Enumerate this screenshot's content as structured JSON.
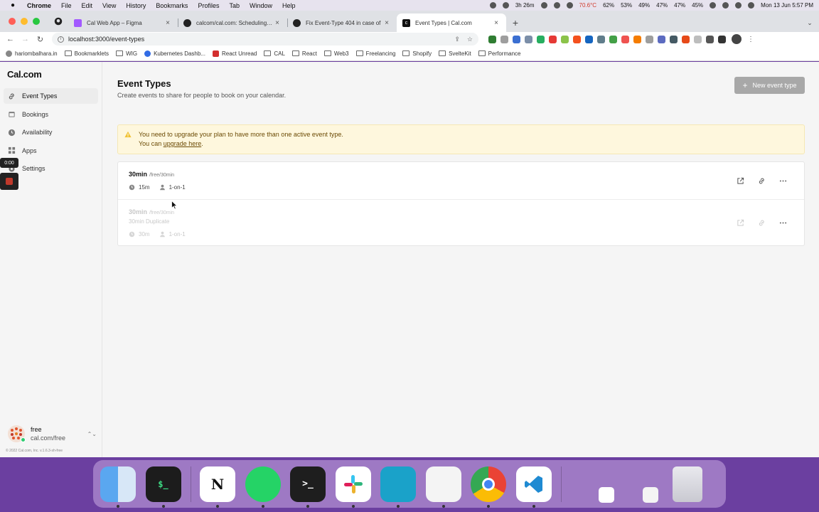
{
  "menubar": {
    "app_name": "Chrome",
    "items": [
      "File",
      "Edit",
      "View",
      "History",
      "Bookmarks",
      "Profiles",
      "Tab",
      "Window",
      "Help"
    ],
    "status": {
      "timer": "3h 26m",
      "temp": "70.6°C",
      "stats": [
        "62%",
        "53%",
        "49%",
        "47%",
        "47%",
        "45%"
      ],
      "datetime": "Mon 13 Jun  5:57 PM"
    }
  },
  "tabs": [
    {
      "title": "Cal Web App – Figma",
      "active": false
    },
    {
      "title": "calcom/cal.com: Scheduling infrastructure",
      "active": false
    },
    {
      "title": "Fix Event-Type 404 in case of",
      "active": false
    },
    {
      "title": "Event Types | Cal.com",
      "active": true
    }
  ],
  "address_bar": {
    "url": "localhost:3000/event-types"
  },
  "bookmarks": [
    "hariombalhara.in",
    "Bookmarklets",
    "WIG",
    "Kubernetes Dashb...",
    "React Unread",
    "CAL",
    "React",
    "Web3",
    "Freelancing",
    "Shopify",
    "SvelteKit",
    "Performance"
  ],
  "sidebar": {
    "brand": "Cal.com",
    "items": [
      {
        "label": "Event Types",
        "icon": "link-icon",
        "active": true
      },
      {
        "label": "Bookings",
        "icon": "calendar-icon",
        "active": false
      },
      {
        "label": "Availability",
        "icon": "clock-icon",
        "active": false
      },
      {
        "label": "Apps",
        "icon": "grid-icon",
        "active": false
      },
      {
        "label": "Settings",
        "icon": "gear-icon",
        "active": false
      }
    ],
    "recording_time": "0:00",
    "user": {
      "name": "free",
      "url": "cal.com/free"
    },
    "footer": "© 2022 Cal.com, Inc. v.1.6.3-sh-free"
  },
  "main": {
    "title": "Event Types",
    "subtitle": "Create events to share for people to book on your calendar.",
    "new_button": "New event type",
    "alert": {
      "line1": "You need to upgrade your plan to have more than one active event type.",
      "line2_prefix": "You can ",
      "link": "upgrade here",
      "line2_suffix": "."
    },
    "events": [
      {
        "title": "30min",
        "slug": "/free/30min",
        "description": "",
        "duration": "15m",
        "type": "1-on-1",
        "hidden": false
      },
      {
        "title": "30min",
        "slug": "/free/30min",
        "description": "30min Duplicate",
        "duration": "30m",
        "type": "1-on-1",
        "hidden": true
      }
    ]
  },
  "colors": {
    "alert_bg": "#fef7dd",
    "alert_text": "#6b4a04",
    "button_disabled": "#a8a8a8",
    "dock_bg": "#c8aae1"
  }
}
